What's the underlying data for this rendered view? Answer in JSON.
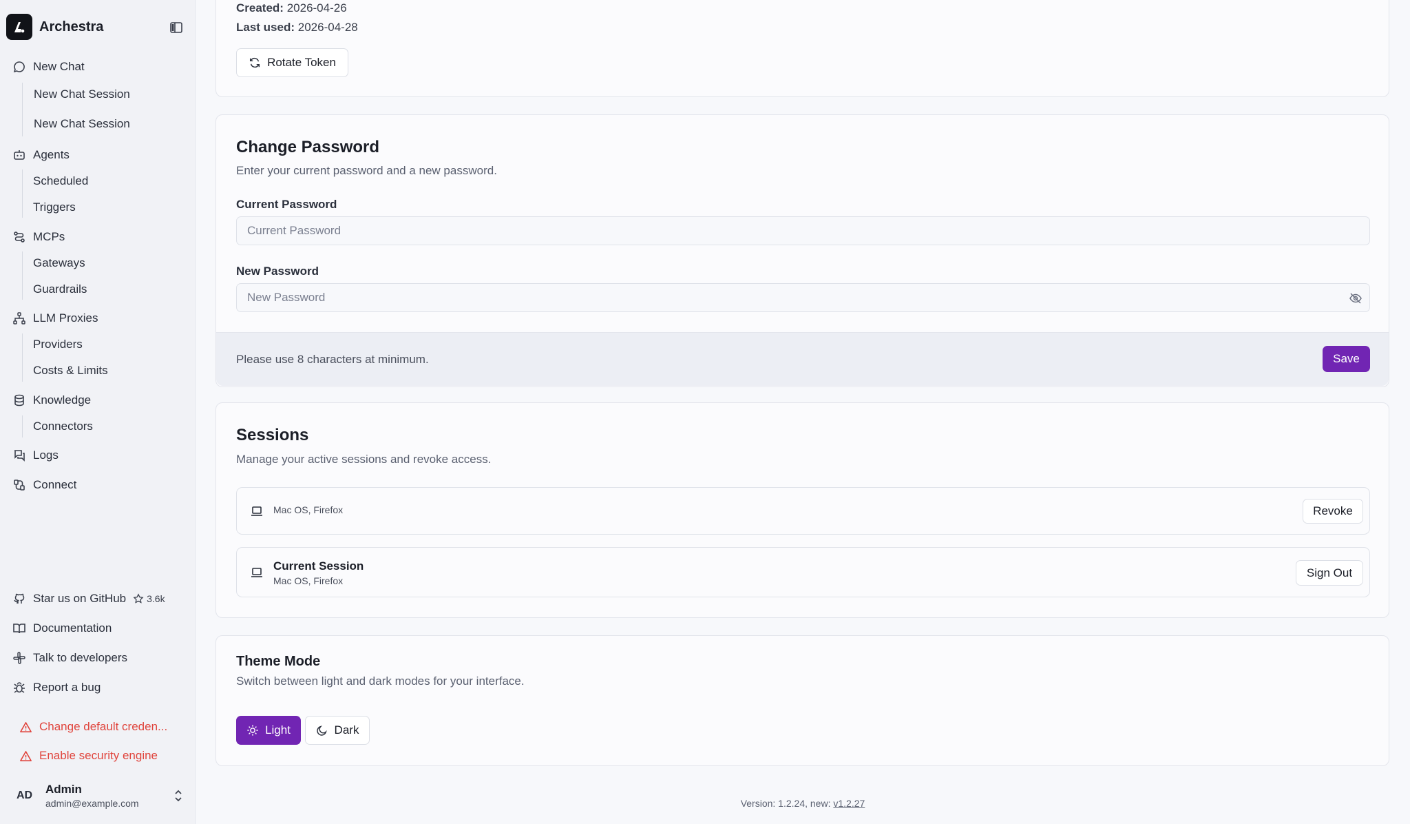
{
  "app": {
    "name": "Archestra"
  },
  "sidebar": {
    "new_chat": "New Chat",
    "chat_sessions": [
      "New Chat Session",
      "New Chat Session"
    ],
    "agents": "Agents",
    "agents_sub": [
      "Scheduled",
      "Triggers"
    ],
    "mcps": "MCPs",
    "mcps_sub": [
      "Gateways",
      "Guardrails"
    ],
    "llm_proxies": "LLM Proxies",
    "llm_sub": [
      "Providers",
      "Costs & Limits"
    ],
    "knowledge": "Knowledge",
    "knowledge_sub": [
      "Connectors"
    ],
    "logs": "Logs",
    "connect": "Connect",
    "github": "Star us on GitHub",
    "github_stars": "3.6k",
    "documentation": "Documentation",
    "talk": "Talk to developers",
    "bug": "Report a bug",
    "warnings": [
      "Change default creden...",
      "Enable security engine"
    ],
    "user": {
      "initials": "AD",
      "name": "Admin",
      "email": "admin@example.com"
    }
  },
  "token": {
    "created_label": "Created:",
    "created_value": "2026-04-26",
    "last_used_label": "Last used:",
    "last_used_value": "2026-04-28",
    "rotate_label": "Rotate Token"
  },
  "password": {
    "title": "Change Password",
    "description": "Enter your current password and a new password.",
    "current_label": "Current Password",
    "current_placeholder": "Current Password",
    "new_label": "New Password",
    "new_placeholder": "New Password",
    "hint": "Please use 8 characters at minimum.",
    "save_label": "Save"
  },
  "sessions": {
    "title": "Sessions",
    "description": "Manage your active sessions and revoke access.",
    "items": [
      {
        "title": "",
        "device": "Mac OS, Firefox",
        "action": "Revoke"
      },
      {
        "title": "Current Session",
        "device": "Mac OS, Firefox",
        "action": "Sign Out"
      }
    ]
  },
  "theme": {
    "title": "Theme Mode",
    "description": "Switch between light and dark modes for your interface.",
    "light": "Light",
    "dark": "Dark",
    "selected": "Light",
    "accent": "#7125b3"
  },
  "footer": {
    "version_text": "Version: 1.2.24, new:",
    "new_version": "v1.2.27"
  }
}
